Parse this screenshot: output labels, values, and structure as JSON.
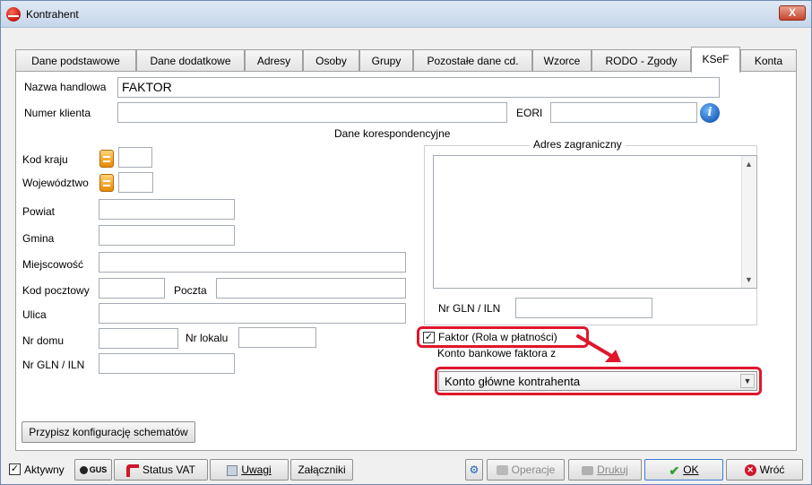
{
  "window": {
    "title": "Kontrahent",
    "close_label": "X"
  },
  "tabs": [
    "Dane podstawowe",
    "Dane dodatkowe",
    "Adresy",
    "Osoby",
    "Grupy",
    "Pozostałe dane cd.",
    "Wzorce",
    "RODO - Zgody",
    "KSeF",
    "Konta"
  ],
  "form": {
    "nazwa_label": "Nazwa handlowa",
    "nazwa_value": "FAKTOR",
    "numer_label": "Numer klienta",
    "numer_value": "",
    "eori_label": "EORI",
    "eori_value": "",
    "section_title": "Dane korespondencyjne",
    "kod_kraju_label": "Kod kraju",
    "wojewodztwo_label": "Województwo",
    "powiat_label": "Powiat",
    "gmina_label": "Gmina",
    "miejscowosc_label": "Miejscowość",
    "kod_pocztowy_label": "Kod pocztowy",
    "poczta_label": "Poczta",
    "ulica_label": "Ulica",
    "nr_domu_label": "Nr domu",
    "nr_lokalu_label": "Nr lokalu",
    "nr_gln_label": "Nr GLN / ILN"
  },
  "foreign": {
    "group_title": "Adres zagraniczny",
    "nr_gln_label": "Nr GLN / ILN"
  },
  "factor": {
    "checkbox_label": "Faktor (Rola w płatności)",
    "checked": true,
    "account_label": "Konto bankowe faktora z",
    "account_value": "Konto główne kontrahenta"
  },
  "actions": {
    "schema_button": "Przypisz konfigurację schematów"
  },
  "bottom": {
    "aktywny_label": "Aktywny",
    "gus_label": "GUS",
    "status_vat_label": "Status VAT",
    "uwagi_label": "Uwagi",
    "zalaczniki_label": "Załączniki",
    "operacje_label": "Operacje",
    "drukuj_label": "Drukuj",
    "ok_label": "OK",
    "wroc_label": "Wróć"
  },
  "colors": {
    "highlight": "#e0162b",
    "accent_blue": "#1b5fb8"
  }
}
